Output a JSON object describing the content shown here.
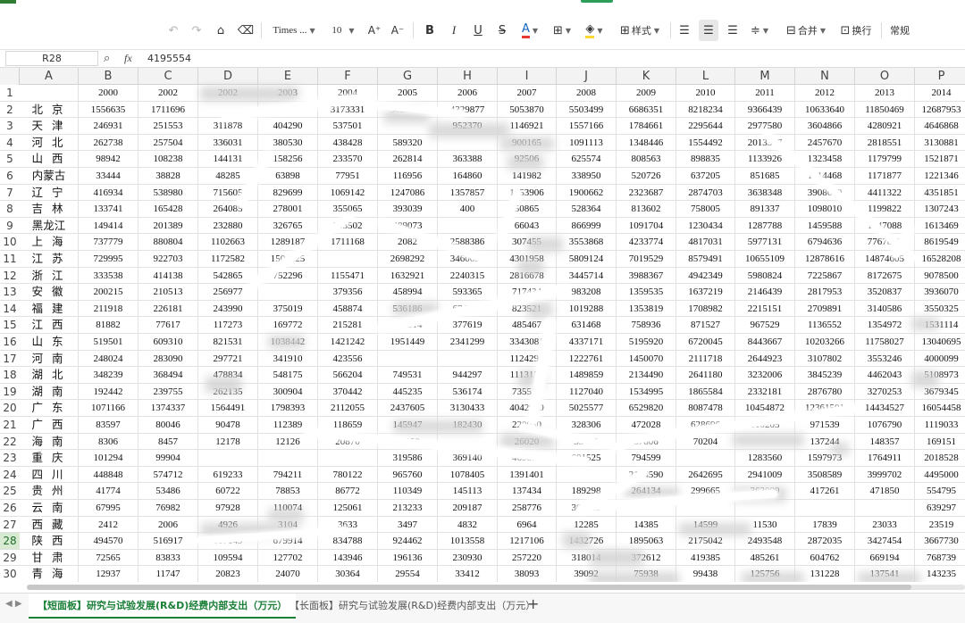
{
  "toolbar": {
    "font_name": "Times ...",
    "font_size": "10",
    "style_label": "样式",
    "merge_label": "合并",
    "wrap_label": "换行",
    "format_label": "常规",
    "font_color": "#e53935",
    "fill_color": "#fdd835"
  },
  "formula_bar": {
    "cell_ref": "R28",
    "value": "4195554"
  },
  "columns": [
    "A",
    "B",
    "C",
    "D",
    "E",
    "F",
    "G",
    "H",
    "I",
    "J",
    "K",
    "L",
    "M",
    "N",
    "O",
    "P"
  ],
  "header_years": [
    "2000",
    "2002",
    "2002",
    "2003",
    "2004",
    "2005",
    "2006",
    "2007",
    "2008",
    "2009",
    "2010",
    "2011",
    "2012",
    "2013",
    "2014"
  ],
  "rows": [
    {
      "n": "2",
      "prov": "北 京",
      "v": [
        "1556635",
        "1711696",
        "",
        "",
        "3173331",
        "3820683",
        "4329877",
        "5053870",
        "5503499",
        "6686351",
        "8218234",
        "9366439",
        "10633640",
        "11850469",
        "12687953"
      ]
    },
    {
      "n": "3",
      "prov": "天 津",
      "v": [
        "246931",
        "251553",
        "311878",
        "404290",
        "537501",
        "",
        "952370",
        "1146921",
        "1557166",
        "1784661",
        "2295644",
        "2977580",
        "3604866",
        "4280921",
        "4646868"
      ]
    },
    {
      "n": "4",
      "prov": "河 北",
      "v": [
        "262738",
        "257504",
        "336031",
        "380530",
        "438428",
        "589320",
        "",
        "900165",
        "1091113",
        "1348446",
        "1554492",
        "2013377",
        "2457670",
        "2818551",
        "3130881"
      ]
    },
    {
      "n": "5",
      "prov": "山 西",
      "v": [
        "98942",
        "108238",
        "144131",
        "158256",
        "233570",
        "262814",
        "363388",
        "92506",
        "625574",
        "808563",
        "898835",
        "1133926",
        "1323458",
        "1179799",
        "1521871"
      ]
    },
    {
      "n": "6",
      "prov": "内蒙古",
      "v": [
        "33444",
        "38828",
        "48285",
        "63898",
        "77951",
        "116956",
        "164860",
        "141982",
        "338950",
        "520726",
        "637205",
        "851685",
        "1014468",
        "1171877",
        "1221346"
      ]
    },
    {
      "n": "7",
      "prov": "辽 宁",
      "v": [
        "416934",
        "538980",
        "715605",
        "829699",
        "1069142",
        "1247086",
        "1357857",
        "1653906",
        "1900662",
        "2323687",
        "2874703",
        "3638348",
        "3908680",
        "4411322",
        "4351851"
      ]
    },
    {
      "n": "8",
      "prov": "吉 林",
      "v": [
        "133741",
        "165428",
        "264085",
        "278001",
        "355065",
        "393039",
        "400",
        "50865",
        "528364",
        "813602",
        "758005",
        "891337",
        "1098010",
        "1199822",
        "1307243"
      ]
    },
    {
      "n": "9",
      "prov": "黑龙江",
      "v": [
        "149414",
        "201389",
        "232880",
        "326765",
        "353502",
        "489073",
        "",
        "66043",
        "866999",
        "1091704",
        "1230434",
        "1287788",
        "1459588",
        "1647088",
        "1613469"
      ]
    },
    {
      "n": "10",
      "prov": "上 海",
      "v": [
        "737779",
        "880804",
        "1102663",
        "1289187",
        "1711168",
        "2082",
        "2588386",
        "307455",
        "3553868",
        "4233774",
        "4817031",
        "5977131",
        "6794636",
        "7767897",
        "8619549"
      ]
    },
    {
      "n": "11",
      "prov": "江 苏",
      "v": [
        "729995",
        "922703",
        "1172582",
        "1504625",
        "",
        "2698292",
        "3460695",
        "4301958",
        "5809124",
        "7019529",
        "8579491",
        "10655109",
        "12878616",
        "14874605",
        "16528208"
      ]
    },
    {
      "n": "12",
      "prov": "浙 江",
      "v": [
        "333538",
        "414138",
        "542865",
        "752296",
        "1155471",
        "1632921",
        "2240315",
        "2816678",
        "3445714",
        "3988367",
        "4942349",
        "5980824",
        "7225867",
        "8172675",
        "9078500"
      ]
    },
    {
      "n": "13",
      "prov": "安 徽",
      "v": [
        "200215",
        "210513",
        "256977",
        "",
        "379356",
        "458994",
        "593365",
        "717434",
        "983208",
        "1359535",
        "1637219",
        "2146439",
        "2817953",
        "3520837",
        "3936070"
      ]
    },
    {
      "n": "14",
      "prov": "福 建",
      "v": [
        "211918",
        "226181",
        "243990",
        "375019",
        "458874",
        "536186",
        "674333",
        "823521",
        "1019288",
        "1353819",
        "1708982",
        "2215151",
        "2709891",
        "3140586",
        "3550325"
      ]
    },
    {
      "n": "15",
      "prov": "江 西",
      "v": [
        "81882",
        "77617",
        "117273",
        "169772",
        "215281",
        "285314",
        "377619",
        "485467",
        "631468",
        "758936",
        "871527",
        "967529",
        "1136552",
        "1354972",
        "1531114"
      ]
    },
    {
      "n": "16",
      "prov": "山 东",
      "v": [
        "519501",
        "609310",
        "821531",
        "1038442",
        "1421242",
        "1951449",
        "2341299",
        "3343081",
        "4337171",
        "5195920",
        "6720045",
        "8443667",
        "10203266",
        "11758027",
        "13040695"
      ]
    },
    {
      "n": "17",
      "prov": "河 南",
      "v": [
        "248024",
        "283090",
        "297721",
        "341910",
        "423556",
        "",
        "",
        "1124299",
        "1222761",
        "1450070",
        "2111718",
        "2644923",
        "3107802",
        "3553246",
        "4000099"
      ]
    },
    {
      "n": "18",
      "prov": "湖 北",
      "v": [
        "348239",
        "368494",
        "478834",
        "548175",
        "566204",
        "749531",
        "944297",
        "1113179",
        "1489859",
        "2134490",
        "2641180",
        "3232006",
        "3845239",
        "4462043",
        "5108973"
      ]
    },
    {
      "n": "19",
      "prov": "湖 南",
      "v": [
        "192442",
        "239755",
        "262135",
        "300904",
        "370442",
        "445235",
        "536174",
        "735536",
        "1127040",
        "1534995",
        "1865584",
        "2332181",
        "2876780",
        "3270253",
        "3679345"
      ]
    },
    {
      "n": "20",
      "prov": "广 东",
      "v": [
        "1071166",
        "1374337",
        "1564491",
        "1798393",
        "2112055",
        "2437605",
        "3130433",
        "4042910",
        "5025577",
        "6529820",
        "8087478",
        "10454872",
        "12361501",
        "14434527",
        "16054458"
      ]
    },
    {
      "n": "21",
      "prov": "广 西",
      "v": [
        "83597",
        "80046",
        "90478",
        "112389",
        "118659",
        "145947",
        "182430",
        "220030",
        "328306",
        "472028",
        "628696",
        "810205",
        "971539",
        "1076790",
        "1119033"
      ]
    },
    {
      "n": "22",
      "prov": "海 南",
      "v": [
        "8306",
        "8457",
        "12178",
        "12126",
        "20870",
        "15050",
        "",
        "26020",
        "33479",
        "57806",
        "70204",
        "",
        "137244",
        "148357",
        "169151"
      ]
    },
    {
      "n": "23",
      "prov": "重 庆",
      "v": [
        "101294",
        "99904",
        "",
        "",
        "",
        "319586",
        "369140",
        "469876",
        "601525",
        "794599",
        "",
        "1283560",
        "1597973",
        "1764911",
        "2018528"
      ]
    },
    {
      "n": "24",
      "prov": "四 川",
      "v": [
        "448848",
        "574712",
        "619233",
        "794211",
        "780122",
        "965760",
        "1078405",
        "1391401",
        "",
        "2144590",
        "2642695",
        "2941009",
        "3508589",
        "3999702",
        "4495000"
      ]
    },
    {
      "n": "25",
      "prov": "贵 州",
      "v": [
        "41774",
        "53486",
        "60722",
        "78853",
        "86772",
        "110349",
        "145113",
        "137434",
        "189298",
        "264134",
        "299665",
        "363089",
        "417261",
        "471850",
        "554795"
      ]
    },
    {
      "n": "26",
      "prov": "云 南",
      "v": [
        "67995",
        "76982",
        "97928",
        "110074",
        "125061",
        "213233",
        "209187",
        "258776",
        "309689",
        "",
        "",
        "",
        "",
        "",
        "639297"
      ]
    },
    {
      "n": "27",
      "prov": "西 藏",
      "v": [
        "2412",
        "2006",
        "4926",
        "3104",
        "3633",
        "3497",
        "4832",
        "6964",
        "12285",
        "14385",
        "14599",
        "11530",
        "17839",
        "23033",
        "23519"
      ]
    },
    {
      "n": "28",
      "prov": "陕 西",
      "v": [
        "494570",
        "516917",
        "607149",
        "679914",
        "834788",
        "924462",
        "1013558",
        "1217106",
        "1432726",
        "1895063",
        "2175042",
        "2493548",
        "2872035",
        "3427454",
        "3667730"
      ]
    },
    {
      "n": "29",
      "prov": "甘 肃",
      "v": [
        "72565",
        "83833",
        "109594",
        "127702",
        "143946",
        "196136",
        "230930",
        "257220",
        "318014",
        "372612",
        "419385",
        "485261",
        "604762",
        "669194",
        "768739"
      ]
    },
    {
      "n": "30",
      "prov": "青 海",
      "v": [
        "12937",
        "11747",
        "20823",
        "24070",
        "30364",
        "29554",
        "33412",
        "38093",
        "39092",
        "75938",
        "99438",
        "125756",
        "131228",
        "137541",
        "143235"
      ]
    }
  ],
  "sheet_tabs": [
    "【短面板】研究与试验发展(R&D)经费内部支出（万元）",
    "【长面板】研究与试验发展(R&D)经费内部支出（万元）"
  ],
  "colors": {
    "accent": "#1a7f37",
    "selected_row": "#d9ead3"
  }
}
